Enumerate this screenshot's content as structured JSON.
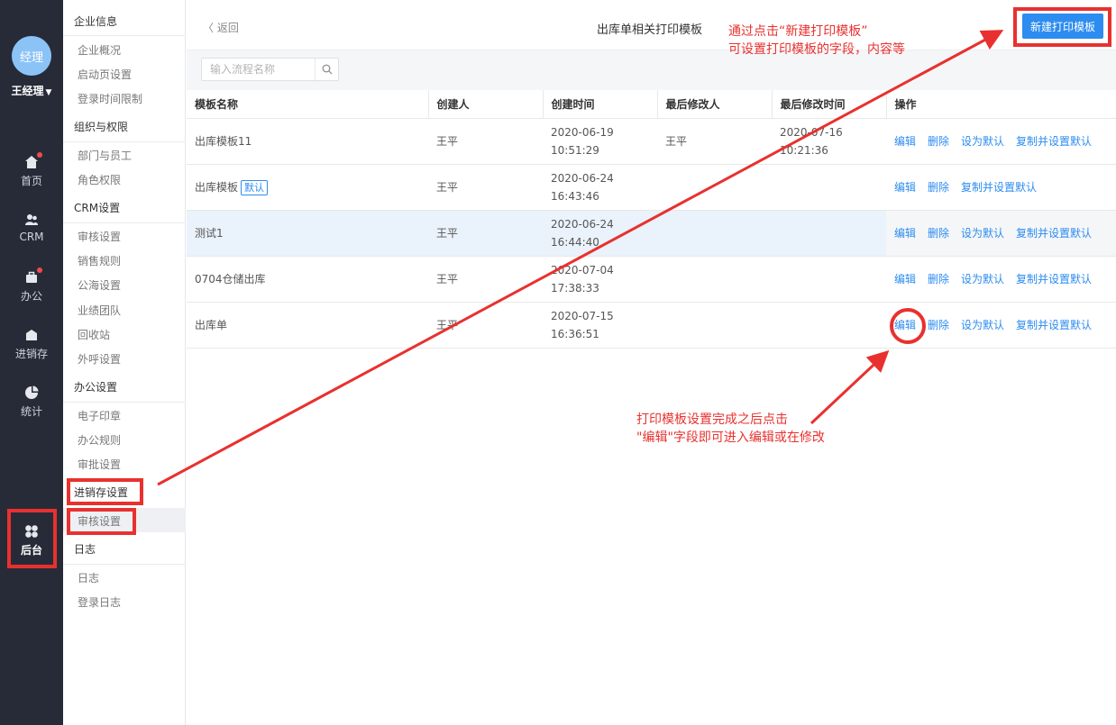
{
  "nav": {
    "avatar_text": "经理",
    "user_name": "王经理",
    "items": [
      {
        "label": "首页",
        "icon": "home-icon"
      },
      {
        "label": "CRM",
        "icon": "crm-icon"
      },
      {
        "label": "办公",
        "icon": "office-icon"
      },
      {
        "label": "进销存",
        "icon": "inventory-icon"
      },
      {
        "label": "统计",
        "icon": "pie-chart-icon"
      },
      {
        "label": "后台",
        "icon": "grid-icon"
      }
    ]
  },
  "menu": {
    "groups": [
      {
        "title": "企业信息",
        "items": [
          "企业概况",
          "启动页设置",
          "登录时间限制"
        ]
      },
      {
        "title": "组织与权限",
        "items": [
          "部门与员工",
          "角色权限"
        ]
      },
      {
        "title": "CRM设置",
        "items": [
          "审核设置",
          "销售规则",
          "公海设置",
          "业绩团队",
          "回收站",
          "外呼设置"
        ]
      },
      {
        "title": "办公设置",
        "items": [
          "电子印章",
          "办公规则",
          "审批设置"
        ]
      },
      {
        "title": "进销存设置",
        "items": [
          "审核设置"
        ]
      },
      {
        "title": "日志",
        "items": [
          "日志",
          "登录日志"
        ]
      }
    ]
  },
  "header": {
    "back_label": "返回",
    "title": "出库单相关打印模板",
    "new_button": "新建打印模板"
  },
  "search": {
    "placeholder": "输入流程名称"
  },
  "table": {
    "columns": [
      "模板名称",
      "创建人",
      "创建时间",
      "最后修改人",
      "最后修改时间",
      "操作"
    ],
    "default_badge": "默认",
    "rows": [
      {
        "name": "出库模板11",
        "creator": "王平",
        "created": "2020-06-19 10:51:29",
        "modifier": "王平",
        "modified": "2020-07-16 10:21:36",
        "ops": [
          "编辑",
          "删除",
          "设为默认",
          "复制并设置默认"
        ]
      },
      {
        "name": "出库模板",
        "creator": "王平",
        "created": "2020-06-24 16:43:46",
        "modifier": "",
        "modified": "",
        "ops": [
          "编辑",
          "删除",
          "复制并设置默认"
        ]
      },
      {
        "name": "测试1",
        "creator": "王平",
        "created": "2020-06-24 16:44:40",
        "modifier": "",
        "modified": "",
        "ops": [
          "编辑",
          "删除",
          "设为默认",
          "复制并设置默认"
        ]
      },
      {
        "name": "0704仓储出库",
        "creator": "王平",
        "created": "2020-07-04 17:38:33",
        "modifier": "",
        "modified": "",
        "ops": [
          "编辑",
          "删除",
          "设为默认",
          "复制并设置默认"
        ]
      },
      {
        "name": "出库单",
        "creator": "王平",
        "created": "2020-07-15 16:36:51",
        "modifier": "",
        "modified": "",
        "ops": [
          "编辑",
          "删除",
          "设为默认",
          "复制并设置默认"
        ]
      }
    ]
  },
  "annotations": {
    "note_top_line1": "通过点击“新建打印模板”",
    "note_top_line2": "可设置打印模板的字段，内容等",
    "note_mid_line1": "打印模板设置完成之后点击",
    "note_mid_line2": "\"编辑\"字段即可进入编辑或在修改",
    "color": "#e8312f"
  }
}
